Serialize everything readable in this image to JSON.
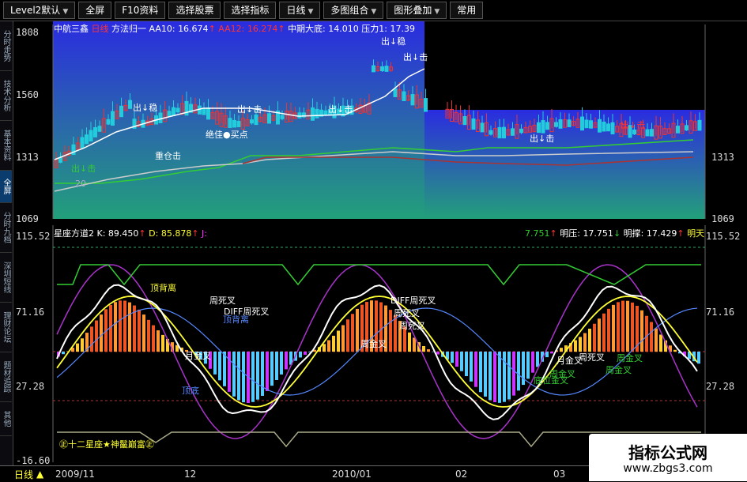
{
  "toolbar": {
    "items": [
      "Level2默认",
      "全屏",
      "F10资料",
      "选择股票",
      "选择指标",
      "日线",
      "多图组合",
      "图形叠加",
      "常用"
    ]
  },
  "side_tabs": [
    "分时走势",
    "技术分析",
    "基本资料",
    "全屏",
    "分时九档",
    "深圳短线",
    "理财论坛",
    "题材追踪",
    "其他"
  ],
  "upper": {
    "legend": {
      "name": "中航三鑫",
      "period": "日线",
      "indicator": "方法归一",
      "aa10_label": "AA10:",
      "aa10_value": "16.674",
      "aa12_label": "AA12:",
      "aa12_value": "16.274",
      "mid_label": "中期大底:",
      "mid_value": "14.010",
      "press_label": "压力1:",
      "press_value": "17.39"
    },
    "y_ticks": [
      "1808",
      "1560",
      "1313",
      "1069"
    ],
    "annotations": [
      "出↓稳",
      "出↓稳",
      "出↓击",
      "出↓击",
      "重仓击",
      "出↓击",
      "绝佳●买点",
      "出↓击",
      "出↓击",
      "出↓击",
      "20"
    ]
  },
  "lower": {
    "legend": {
      "name": "星座方道2",
      "k_label": "K:",
      "k_value": "89.450",
      "d_label": "D:",
      "d_value": "85.878",
      "j_label": "J:",
      "tail": "7.751",
      "ming_label": "明压:",
      "ming_value": "17.751",
      "mingc_label": "明撑:",
      "mingc_value": "17.429",
      "mingtian": "明天"
    },
    "y_ticks": [
      "115.52",
      "71.16",
      "27.28",
      "-16.60"
    ],
    "annotations": [
      "顶背离",
      "周死叉",
      "DIFF周死叉",
      "周死叉",
      "顶背离",
      "DIFF周死叉",
      "周死叉",
      "月金叉",
      "周金叉",
      "顶底",
      "周金叉",
      "月金叉",
      "底位金叉",
      "周死叉",
      "周金叉",
      "周金叉"
    ],
    "footer_label": "㊣十二星座★神鬣巅富㊣"
  },
  "status": {
    "label": "日线",
    "dates": [
      "2009/11",
      "12",
      "2010/01",
      "02",
      "03"
    ]
  },
  "watermark": {
    "title": "指标公式网",
    "url": "www.zbgs3.com"
  }
}
